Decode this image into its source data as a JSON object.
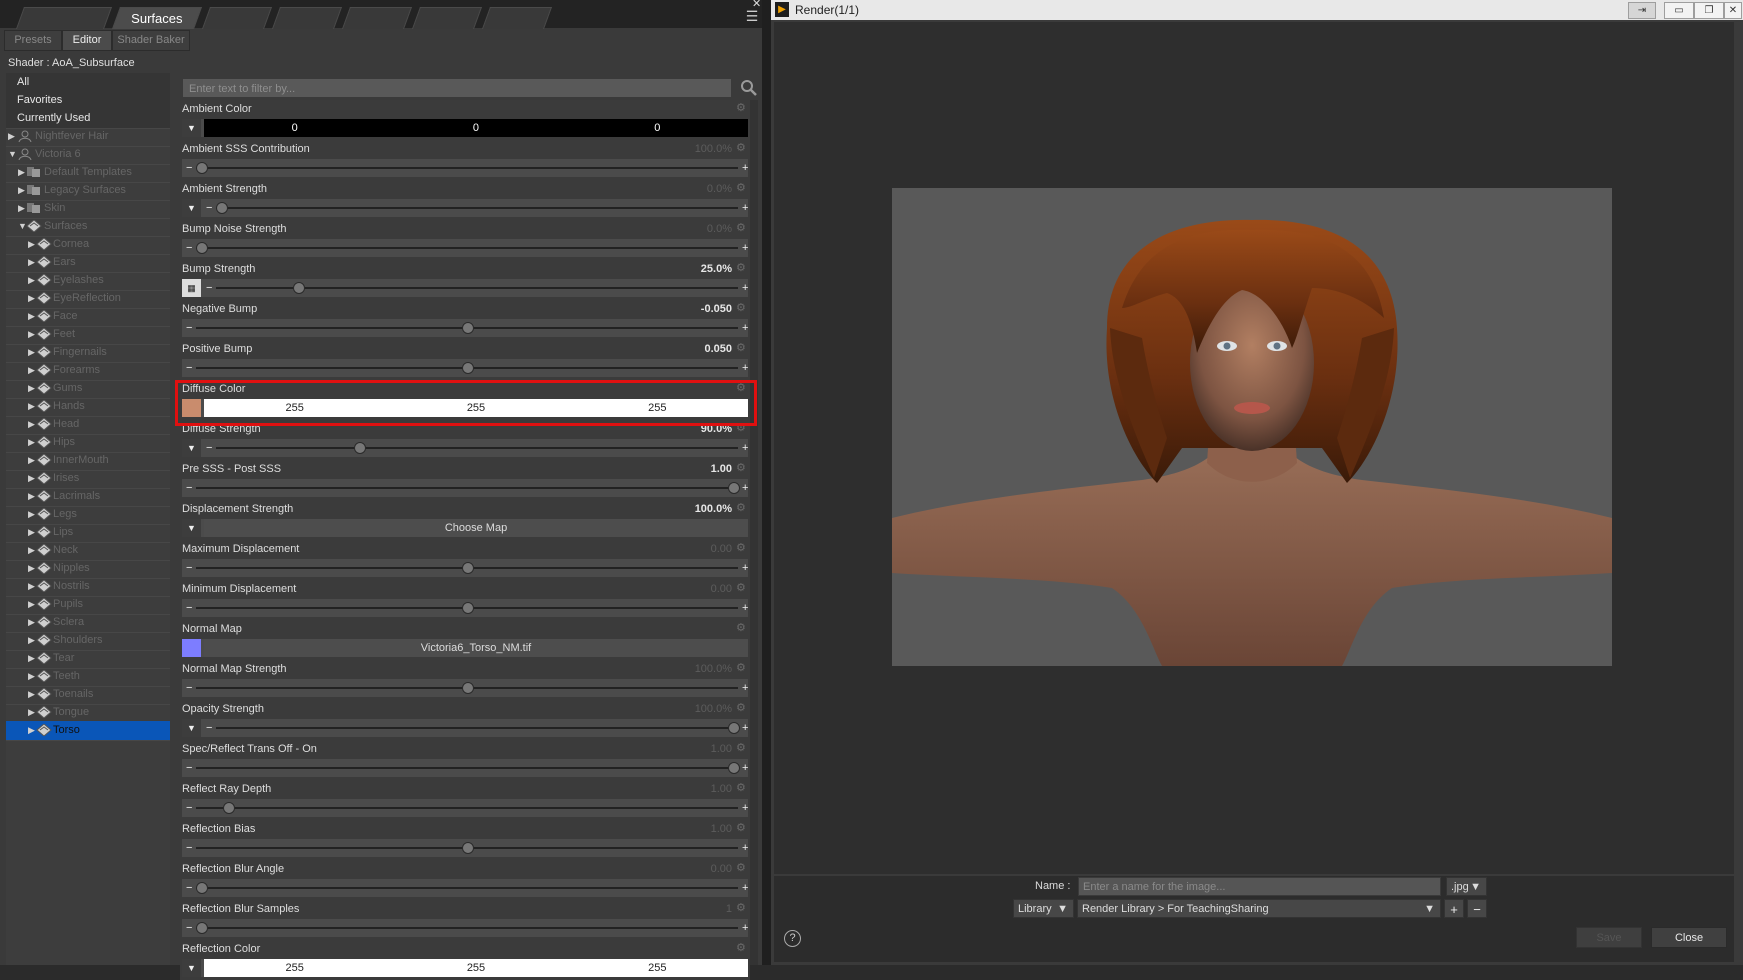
{
  "surfaces_pane": {
    "title": "Surfaces",
    "subtabs": [
      "Presets",
      "Editor",
      "Shader Baker"
    ],
    "shader_label": "Shader : AoA_Subsurface",
    "tree": {
      "top_items": [
        "All",
        "Favorites",
        "Currently Used"
      ],
      "figures": [
        "Nightfever Hair",
        "Victoria 6"
      ],
      "groups": [
        "Default Templates",
        "Legacy Surfaces",
        "Skin",
        "Surfaces"
      ],
      "surfaces": [
        "Cornea",
        "Ears",
        "Eyelashes",
        "EyeReflection",
        "Face",
        "Feet",
        "Fingernails",
        "Forearms",
        "Gums",
        "Hands",
        "Head",
        "Hips",
        "InnerMouth",
        "Irises",
        "Lacrimals",
        "Legs",
        "Lips",
        "Neck",
        "Nipples",
        "Nostrils",
        "Pupils",
        "Sclera",
        "Shoulders",
        "Tear",
        "Teeth",
        "Toenails",
        "Tongue",
        "Torso"
      ],
      "selected": "Torso"
    },
    "filter_placeholder": "Enter text to filter by...",
    "properties": [
      {
        "label": "Ambient Color",
        "value": "",
        "kind": "color",
        "rgb": [
          "0",
          "0",
          "0"
        ],
        "swatch": "#000000"
      },
      {
        "label": "Ambient SSS Contribution",
        "value": "100.0%",
        "kind": "slider",
        "level": 0.0,
        "dim": true
      },
      {
        "label": "Ambient Strength",
        "value": "0.0%",
        "kind": "slider",
        "level": 0.0,
        "dim": true,
        "btn": "dropdown"
      },
      {
        "label": "Bump Noise Strength",
        "value": "0.0%",
        "kind": "slider",
        "level": 0.0,
        "dim": true
      },
      {
        "label": "Bump Strength",
        "value": "25.0%",
        "kind": "slider",
        "level": 0.15,
        "dim": false,
        "btn": "map"
      },
      {
        "label": "Negative Bump",
        "value": "-0.050",
        "kind": "slider",
        "level": 0.5,
        "dim": false
      },
      {
        "label": "Positive Bump",
        "value": "0.050",
        "kind": "slider",
        "level": 0.5,
        "dim": false
      },
      {
        "label": "Diffuse Color",
        "value": "",
        "kind": "color",
        "rgb": [
          "255",
          "255",
          "255"
        ],
        "swatch": "#ffffff",
        "btn": "skin"
      },
      {
        "label": "Diffuse Strength",
        "value": "90.0%",
        "kind": "slider",
        "level": 0.27,
        "dim": false,
        "btn": "dropdown"
      },
      {
        "label": "Pre SSS - Post SSS",
        "value": "1.00",
        "kind": "slider",
        "level": 1.0,
        "dim": false
      },
      {
        "label": "Displacement Strength",
        "value": "100.0%",
        "kind": "map",
        "map": "Choose Map",
        "dim": false,
        "btn": "dropdown"
      },
      {
        "label": "Maximum Displacement",
        "value": "0.00",
        "kind": "slider",
        "level": 0.5,
        "dim": true
      },
      {
        "label": "Minimum Displacement",
        "value": "0.00",
        "kind": "slider",
        "level": 0.5,
        "dim": true
      },
      {
        "label": "Normal Map",
        "value": "",
        "kind": "map",
        "map": "Victoria6_Torso_NM.tif",
        "dim": false,
        "btn": "normal"
      },
      {
        "label": "Normal Map Strength",
        "value": "100.0%",
        "kind": "slider",
        "level": 0.5,
        "dim": true
      },
      {
        "label": "Opacity Strength",
        "value": "100.0%",
        "kind": "slider",
        "level": 1.0,
        "dim": true,
        "btn": "dropdown"
      },
      {
        "label": "Spec/Reflect Trans Off - On",
        "value": "1.00",
        "kind": "slider",
        "level": 1.0,
        "dim": true
      },
      {
        "label": "Reflect Ray Depth",
        "value": "1.00",
        "kind": "slider",
        "level": 0.05,
        "dim": true
      },
      {
        "label": "Reflection Bias",
        "value": "1.00",
        "kind": "slider",
        "level": 0.5,
        "dim": true
      },
      {
        "label": "Reflection Blur Angle",
        "value": "0.00",
        "kind": "slider",
        "level": 0.0,
        "dim": true
      },
      {
        "label": "Reflection Blur Samples",
        "value": "1",
        "kind": "slider",
        "level": 0.0,
        "dim": true
      },
      {
        "label": "Reflection Color",
        "value": "",
        "kind": "color",
        "rgb": [
          "255",
          "255",
          "255"
        ],
        "swatch": "#ffffff"
      }
    ],
    "highlight_color": "#e01010",
    "selection_color": "#0a56b8"
  },
  "render_window": {
    "title": "Render(1/1)",
    "name_label": "Name :",
    "name_placeholder": "Enter a name for the image...",
    "extension": ".jpg",
    "library": "Library",
    "library_path": "Render Library > For TeachingSharing",
    "plus": "+",
    "minus": "−",
    "help": "?",
    "save": "Save",
    "close": "Close"
  }
}
